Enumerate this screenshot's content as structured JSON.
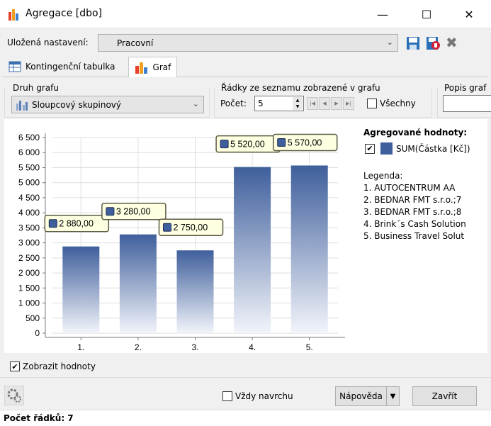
{
  "window": {
    "title": "Agregace [dbo]",
    "minimize": "—",
    "maximize": "☐",
    "close": "✕"
  },
  "settings": {
    "label": "Uložená nastavení:",
    "value": "Pracovní"
  },
  "tabs": [
    {
      "label": "Kontingenční tabulka"
    },
    {
      "label": "Graf"
    }
  ],
  "chart_type": {
    "label": "Druh grafu",
    "value": "Sloupcový skupinový"
  },
  "rows": {
    "label": "Řádky ze seznamu zobrazené v grafu",
    "count_label": "Počet:",
    "count_value": "5",
    "all_label": "Všechny"
  },
  "description": {
    "label": "Popis graf"
  },
  "chart_data": {
    "type": "bar",
    "categories": [
      "1.",
      "2.",
      "3.",
      "4.",
      "5."
    ],
    "series": [
      {
        "name": "SUM(Částka [Kč])",
        "values": [
          2880,
          3280,
          2750,
          5520,
          5570
        ]
      }
    ],
    "value_labels": [
      "2 880,00",
      "3 280,00",
      "2 750,00",
      "5 520,00",
      "5 570,00"
    ],
    "yticks": [
      "0",
      "500",
      "1 000",
      "1 500",
      "2 000",
      "2 500",
      "3 000",
      "3 500",
      "4 000",
      "4 500",
      "5 000",
      "5 500",
      "6 000",
      "6 500"
    ],
    "ylim": [
      0,
      6500
    ],
    "grid": true,
    "bar_color": "#3f5f9c"
  },
  "aggregated": {
    "title": "Agregované hodnoty:",
    "series_name": "SUM(Částka [Kč])",
    "color": "#3f5f9c"
  },
  "legend": {
    "title": "Legenda:",
    "items": [
      "1. AUTOCENTRUM AA",
      "2. BEDNAR FMT s.r.o.;7",
      "3. BEDNAR FMT s.r.o.;8",
      "4. Brink´s Cash Solution",
      "5. Business Travel Solut"
    ]
  },
  "show_values": {
    "label": "Zobrazit hodnoty"
  },
  "footer": {
    "always_on_top": "Vždy navrchu",
    "help": "Nápověda",
    "close": "Zavřít"
  },
  "status": {
    "rows": "Počet řádků: 7"
  }
}
